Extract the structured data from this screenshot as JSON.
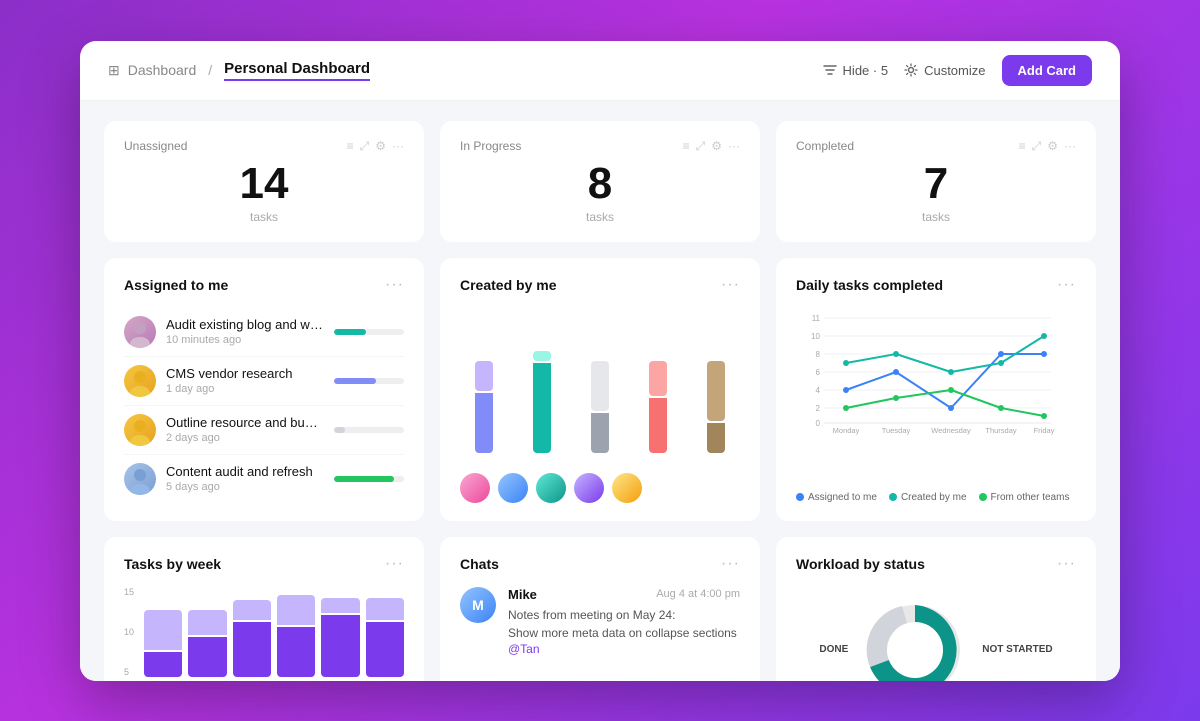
{
  "header": {
    "breadcrumb_dashboard": "Dashboard",
    "breadcrumb_sep": "/",
    "breadcrumb_current": "Personal Dashboard",
    "hide_label": "Hide · 5",
    "customize_label": "Customize",
    "add_card_label": "Add Card"
  },
  "stats": [
    {
      "label": "Unassigned",
      "number": "14",
      "sublabel": "tasks"
    },
    {
      "label": "In Progress",
      "number": "8",
      "sublabel": "tasks"
    },
    {
      "label": "Completed",
      "number": "7",
      "sublabel": "tasks"
    }
  ],
  "assigned_to_me": {
    "title": "Assigned to me",
    "tasks": [
      {
        "name": "Audit existing blog and website",
        "time": "10 minutes ago",
        "progress": 45,
        "color": "teal",
        "avatar_class": "avatar-1"
      },
      {
        "name": "CMS vendor research",
        "time": "1 day ago",
        "progress": 60,
        "color": "blue",
        "avatar_class": "avatar-2"
      },
      {
        "name": "Outline resource and budget needs",
        "time": "2 days ago",
        "progress": 15,
        "color": "gray",
        "avatar_class": "avatar-3"
      },
      {
        "name": "Content audit and refresh",
        "time": "5 days ago",
        "progress": 85,
        "color": "green",
        "avatar_class": "avatar-4"
      }
    ]
  },
  "created_by_me": {
    "title": "Created by me",
    "bars": [
      {
        "heights": [
          60,
          30
        ],
        "colors": [
          "#818cf8",
          "#c4b5fd"
        ]
      },
      {
        "heights": [
          90,
          10
        ],
        "colors": [
          "#2dd4bf",
          "#99f6e4"
        ]
      },
      {
        "heights": [
          40,
          50
        ],
        "colors": [
          "#9ca3af",
          "#d1d5db"
        ]
      },
      {
        "heights": [
          55,
          35
        ],
        "colors": [
          "#f87171",
          "#fca5a5"
        ]
      },
      {
        "heights": [
          30,
          60
        ],
        "colors": [
          "#a3855c",
          "#c4a57a"
        ]
      }
    ],
    "avatars": [
      "ma-pink",
      "ma-blue",
      "ma-teal",
      "ma-purple",
      "ma-yellow"
    ]
  },
  "daily_tasks": {
    "title": "Daily tasks completed",
    "y_labels": [
      "11",
      "10",
      "8",
      "6",
      "4",
      "2",
      "0"
    ],
    "x_labels": [
      "Monday",
      "Tuesday",
      "Wednesday",
      "Thursday",
      "Friday"
    ],
    "legend": [
      {
        "label": "Assigned to me",
        "color": "#3b82f6"
      },
      {
        "label": "Created by me",
        "color": "#14b8a6"
      },
      {
        "label": "From other teams",
        "color": "#22c55e"
      }
    ]
  },
  "tasks_by_week": {
    "title": "Tasks by week",
    "y_labels": [
      "15",
      "10",
      "5"
    ],
    "bars": [
      {
        "val1": 40,
        "val2": 30
      },
      {
        "val1": 60,
        "val2": 40
      },
      {
        "val1": 70,
        "val2": 50
      },
      {
        "val1": 65,
        "val2": 45
      },
      {
        "val1": 80,
        "val2": 55
      },
      {
        "val1": 75,
        "val2": 50
      }
    ]
  },
  "chats": {
    "title": "Chats",
    "item": {
      "name": "Mike",
      "time": "Aug 4 at 4:00 pm",
      "message1": "Notes from meeting on May 24:",
      "message2": "Show more meta data on collapse sections",
      "mention": "@Tan"
    }
  },
  "workload": {
    "title": "Workload by status",
    "label_left": "DONE",
    "label_right": "NOT STARTED"
  }
}
